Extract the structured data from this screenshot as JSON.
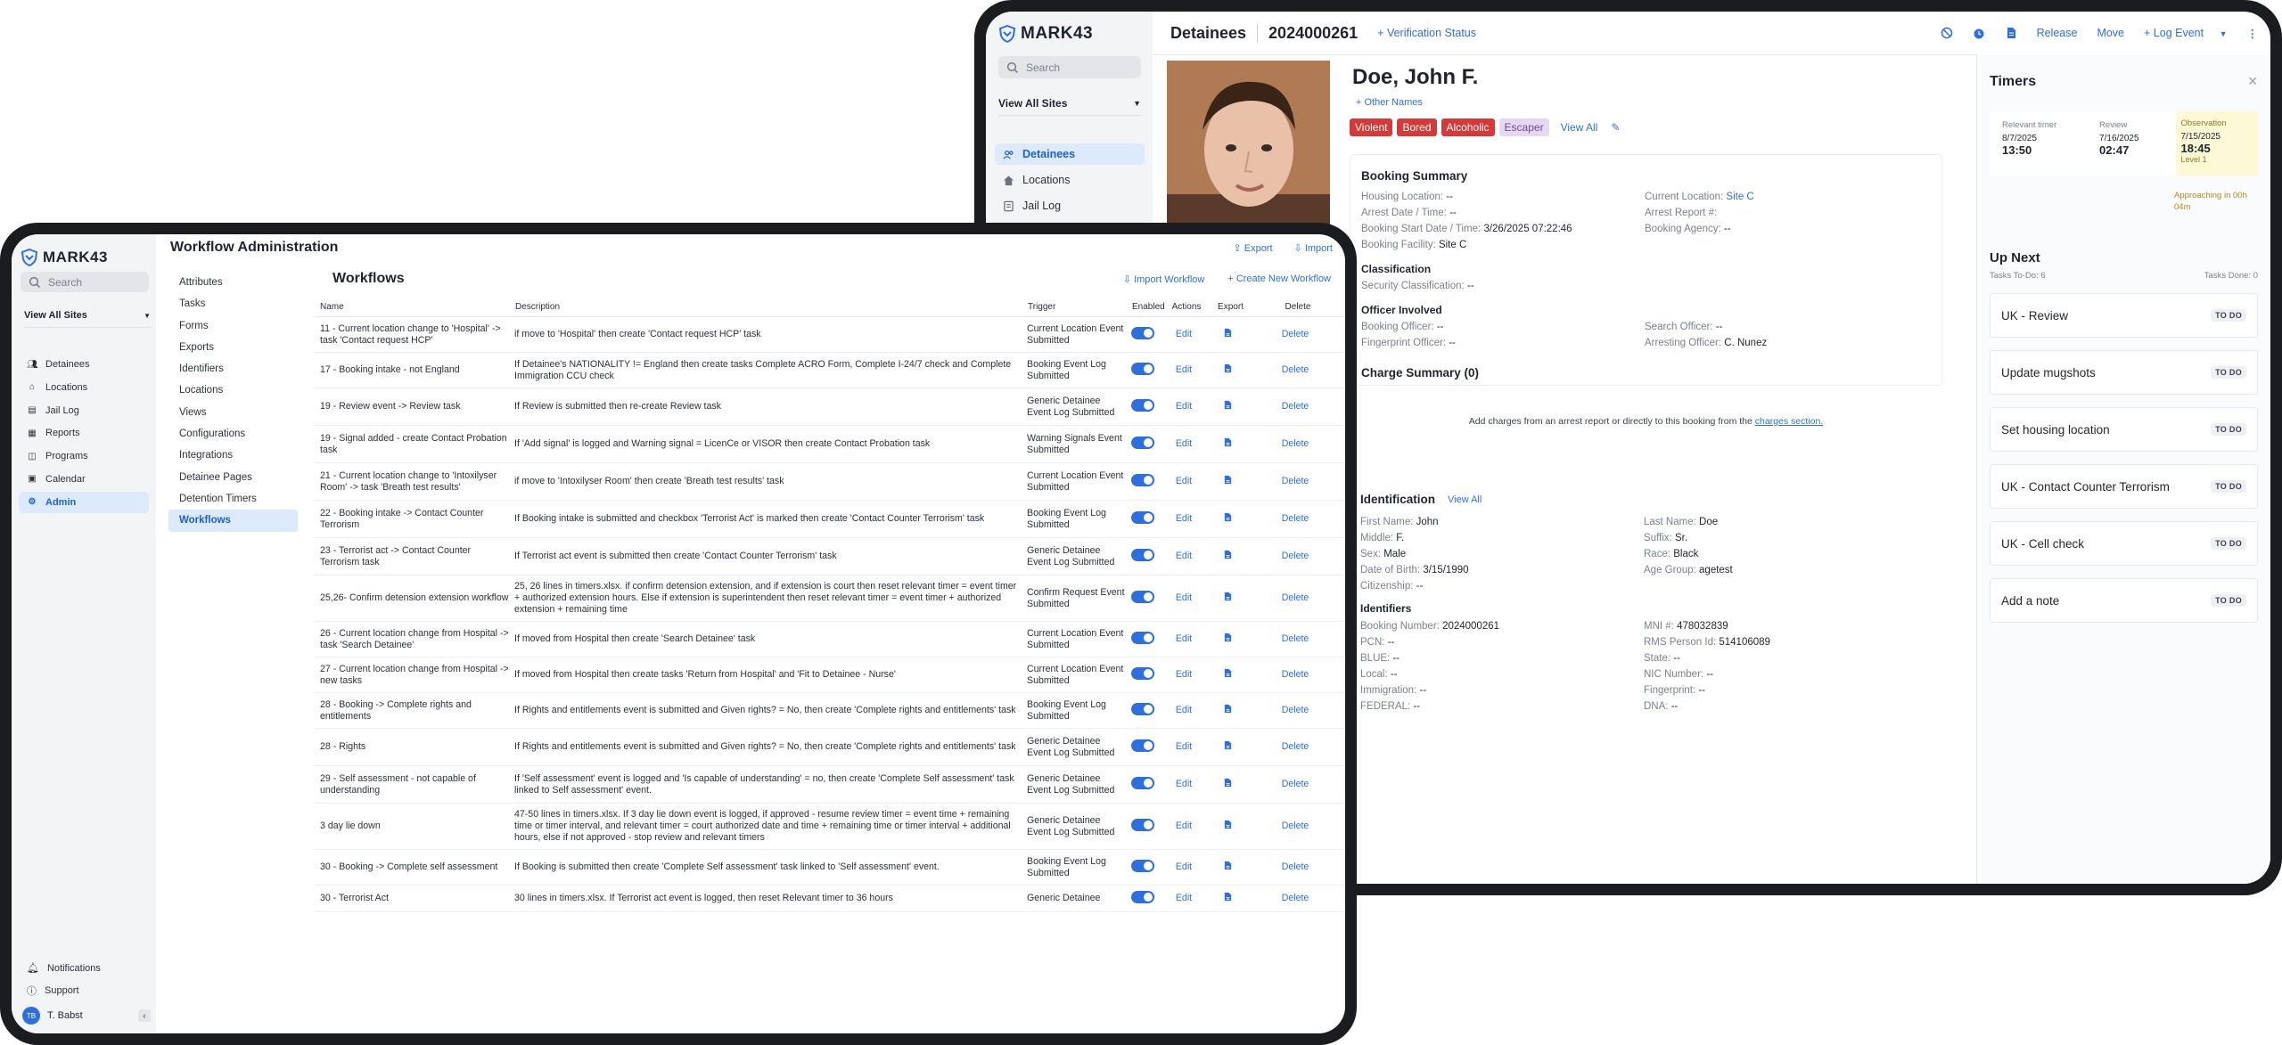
{
  "brand": {
    "name": "MARK43"
  },
  "detainee_app": {
    "sidebar": {
      "search_placeholder": "Search",
      "site_select": "View All Sites",
      "items": [
        {
          "label": "Detainees",
          "active": true
        },
        {
          "label": "Locations"
        },
        {
          "label": "Jail Log"
        }
      ]
    },
    "header": {
      "section": "Detainees",
      "booking_number": "2024000261",
      "verification": "Verification Status",
      "actions": [
        "Release",
        "Move",
        "Log Event"
      ]
    },
    "person": {
      "name": "Doe, John F.",
      "other_names": "Other Names",
      "tags": [
        "Violent",
        "Bored",
        "Alcoholic",
        "Escaper"
      ],
      "view_all": "View All"
    },
    "booking_summary": {
      "title": "Booking Summary",
      "fields": [
        {
          "label": "Housing Location:",
          "value": "--"
        },
        {
          "label": "Current Location:",
          "value": "Site C"
        },
        {
          "label": "Arrest Date / Time:",
          "value": "--"
        },
        {
          "label": "Arrest Report #:",
          "value": ""
        },
        {
          "label": "Booking Start Date / Time:",
          "value": "3/26/2025 07:22:46"
        },
        {
          "label": "Booking Agency:",
          "value": "--"
        },
        {
          "label": "Booking Facility:",
          "value": "Site C"
        }
      ],
      "classification_title": "Classification",
      "security_classification": {
        "label": "Security Classification:",
        "value": "--"
      },
      "officer_title": "Officer Involved",
      "officers": [
        {
          "label": "Booking Officer:",
          "value": "--"
        },
        {
          "label": "Search Officer:",
          "value": "--"
        },
        {
          "label": "Fingerprint Officer:",
          "value": "--"
        },
        {
          "label": "Arresting Officer:",
          "value": "C. Nunez"
        }
      ]
    },
    "charge_summary": {
      "title": "Charge Summary (0)",
      "empty_text": "Add charges from an arrest report or directly to this booking from the",
      "empty_link": "charges section."
    },
    "identification": {
      "title": "Identification",
      "view_all": "View All",
      "fields": [
        {
          "label": "First Name:",
          "value": "John"
        },
        {
          "label": "Last Name:",
          "value": "Doe"
        },
        {
          "label": "Middle:",
          "value": "F."
        },
        {
          "label": "Suffix:",
          "value": "Sr."
        },
        {
          "label": "Sex:",
          "value": "Male"
        },
        {
          "label": "Race:",
          "value": "Black"
        },
        {
          "label": "Date of Birth:",
          "value": "3/15/1990"
        },
        {
          "label": "Age Group:",
          "value": "agetest"
        },
        {
          "label": "Citizenship:",
          "value": "--"
        }
      ],
      "identifiers_title": "Identifiers",
      "identifiers": [
        {
          "label": "Booking Number:",
          "value": "2024000261"
        },
        {
          "label": "MNI #:",
          "value": "478032839"
        },
        {
          "label": "PCN:",
          "value": "--"
        },
        {
          "label": "RMS Person Id:",
          "value": "514106089"
        },
        {
          "label": "BLUE:",
          "value": "--"
        },
        {
          "label": "State:",
          "value": "--"
        },
        {
          "label": "Local:",
          "value": "--"
        },
        {
          "label": "NIC Number:",
          "value": "--"
        },
        {
          "label": "Immigration:",
          "value": "--"
        },
        {
          "label": "Fingerprint:",
          "value": "--"
        },
        {
          "label": "FEDERAL:",
          "value": "--"
        },
        {
          "label": "DNA:",
          "value": "--"
        }
      ]
    },
    "timers": {
      "title": "Timers",
      "items": [
        {
          "label": "Relevant timer",
          "date": "8/7/2025",
          "time": "13:50"
        },
        {
          "label": "Review",
          "date": "7/16/2025",
          "time": "02:47"
        },
        {
          "label": "Observation",
          "date": "7/15/2025",
          "time": "18:45",
          "level": "Level 1",
          "warning": "Approaching in 00h 04m"
        }
      ],
      "up_next": "Up Next",
      "tasks_todo": "Tasks To-Do: 6",
      "tasks_done": "Tasks Done: 0",
      "tasks": [
        "UK - Review",
        "Update mugshots",
        "Set housing location",
        "UK - Contact Counter Terrorism",
        "UK - Cell check",
        "Add a note"
      ],
      "todo_badge": "TO DO"
    }
  },
  "admin_app": {
    "title": "Workflow Administration",
    "export": "Export",
    "import": "Import",
    "sidebar": {
      "search_placeholder": "Search",
      "site_select": "View All Sites",
      "items": [
        "Detainees",
        "Locations",
        "Jail Log",
        "Reports",
        "Programs",
        "Calendar",
        "Admin"
      ],
      "bottom": [
        "Notifications",
        "Support"
      ],
      "user": {
        "initials": "TB",
        "name": "T. Babst"
      }
    },
    "subnav": [
      "Attributes",
      "Tasks",
      "Forms",
      "Exports",
      "Identifiers",
      "Locations",
      "Views",
      "Configurations",
      "Integrations",
      "Detainee Pages",
      "Detention Timers",
      "Workflows"
    ],
    "workflows": {
      "title": "Workflows",
      "import_btn": "Import Workflow",
      "create_btn": "Create New Workflow",
      "columns": [
        "Name",
        "Description",
        "Trigger",
        "Enabled",
        "Actions",
        "Export",
        "Delete"
      ],
      "edit_label": "Edit",
      "delete_label": "Delete",
      "rows": [
        {
          "name": "11 - Current location change to 'Hospital' -> task 'Contact request HCP'",
          "desc": "if move to 'Hospital' then create 'Contact request HCP' task",
          "trigger": "Current Location Event Submitted"
        },
        {
          "name": "17 - Booking intake - not England",
          "desc": "If Detainee's NATIONALITY != England then create tasks Complete ACRO Form, Complete I-24/7 check and Complete Immigration CCU check",
          "trigger": "Booking Event Log Submitted"
        },
        {
          "name": "19 - Review event -> Review task",
          "desc": "If Review is submitted then re-create Review task",
          "trigger": "Generic Detainee Event Log Submitted"
        },
        {
          "name": "19 - Signal added - create Contact Probation task",
          "desc": "If 'Add signal' is logged and Warning signal = LicenCe or VISOR then create Contact Probation task",
          "trigger": "Warning Signals Event Submitted"
        },
        {
          "name": "21 - Current location change to 'Intoxilyser Room' -> task 'Breath test results'",
          "desc": "if move to 'Intoxilyser Room' then create 'Breath test results' task",
          "trigger": "Current Location Event Submitted"
        },
        {
          "name": "22 - Booking intake -> Contact Counter Terrorism",
          "desc": "If Booking intake is submitted and checkbox 'Terrorist Act' is marked then create 'Contact Counter Terrorism' task",
          "trigger": "Booking Event Log Submitted"
        },
        {
          "name": "23 - Terrorist act -> Contact Counter Terrorism task",
          "desc": "If Terrorist act event is submitted then create 'Contact Counter Terrorism' task",
          "trigger": "Generic Detainee Event Log Submitted"
        },
        {
          "name": "25,26- Confirm detension extension workflow",
          "desc": "25, 26 lines in timers.xlsx. if confirm detension extension, and if extension is court then reset relevant timer = event timer + authorized extension hours. Else if extension is superintendent then reset relevant timer = event timer + authorized extension + remaining time",
          "trigger": "Confirm Request Event Submitted"
        },
        {
          "name": "26 - Current location change from Hospital -> task 'Search Detainee'",
          "desc": "If moved from Hospital then create 'Search Detainee' task",
          "trigger": "Current Location Event Submitted"
        },
        {
          "name": "27 - Current location change from Hospital -> new tasks",
          "desc": "If moved from Hospital then create tasks 'Return from Hospital' and 'Fit to Detainee - Nurse'",
          "trigger": "Current Location Event Submitted"
        },
        {
          "name": "28 - Booking -> Complete rights and entitlements",
          "desc": "If Rights and entitlements event is submitted and Given rights? = No, then create 'Complete rights and entitlements' task",
          "trigger": "Booking Event Log Submitted"
        },
        {
          "name": "28 - Rights",
          "desc": "If Rights and entitlements event is submitted and Given rights? = No, then create 'Complete rights and entitlements' task",
          "trigger": "Generic Detainee Event Log Submitted"
        },
        {
          "name": "29 - Self assessment - not capable of understanding",
          "desc": "If 'Self assessment' event is logged and 'Is capable of understanding' = no, then create 'Complete Self assessment' task linked to Self assessment' event.",
          "trigger": "Generic Detainee Event Log Submitted"
        },
        {
          "name": "3 day lie down",
          "desc": "47-50 lines in timers.xlsx. If 3 day lie down event is logged, if approved - resume review timer = event time + remaining time or timer interval, and relevant timer = court authorized date and time + remaining time or timer interval + additional hours, else if not approved - stop review and relevant timers",
          "trigger": "Generic Detainee Event Log Submitted"
        },
        {
          "name": "30 - Booking -> Complete self assessment",
          "desc": "If Booking is submitted then create 'Complete Self assessment' task linked to 'Self assessment' event.",
          "trigger": "Booking Event Log Submitted"
        },
        {
          "name": "30 - Terrorist Act",
          "desc": "30 lines in timers.xlsx. If Terrorist act event is logged, then reset Relevant timer to 36 hours",
          "trigger": "Generic Detainee"
        }
      ]
    }
  }
}
